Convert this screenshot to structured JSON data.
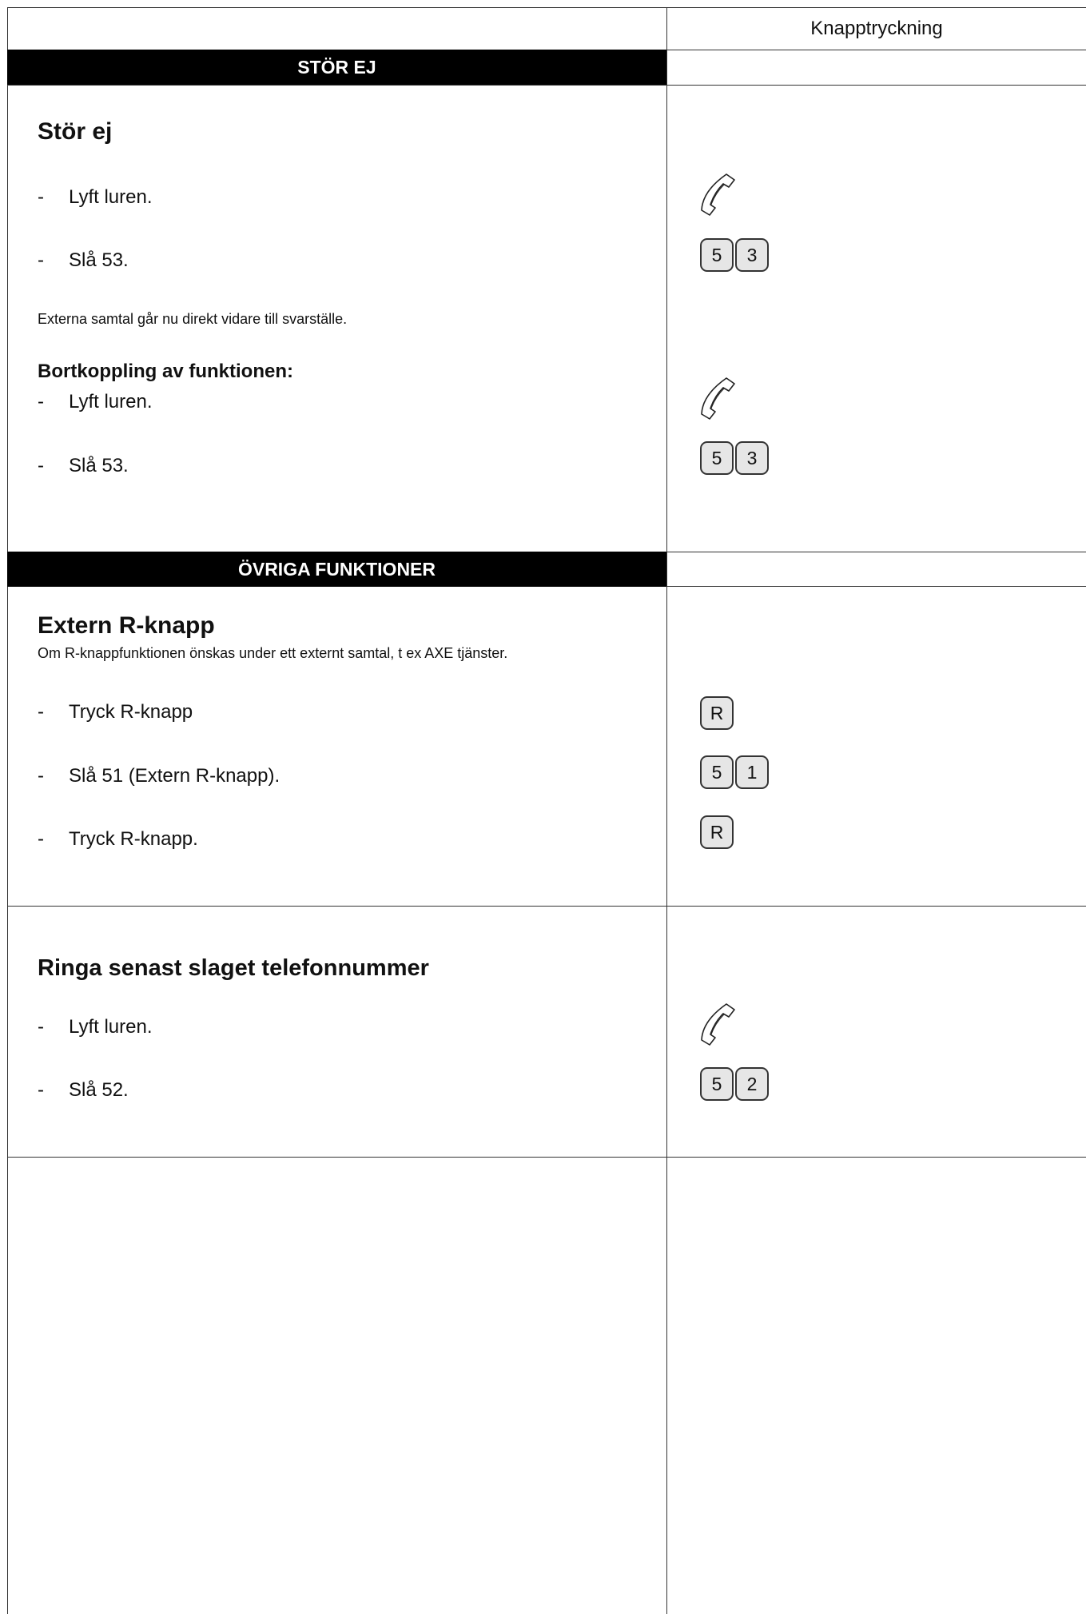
{
  "header": {
    "column_label": "Knapptryckning"
  },
  "sections": [
    {
      "banner": "STÖR EJ",
      "title": "Stör ej",
      "steps": [
        {
          "text": "Lyft luren.",
          "icon": "handset-icon"
        },
        {
          "text": "Slå 53.",
          "keys": [
            "5",
            "3"
          ]
        }
      ],
      "note": "Externa samtal går nu direkt vidare till svarställe.",
      "sub_heading": "Bortkoppling av funktionen:",
      "sub_steps": [
        {
          "text": "Lyft luren.",
          "icon": "handset-icon"
        },
        {
          "text": "Slå 53.",
          "keys": [
            "5",
            "3"
          ]
        }
      ]
    },
    {
      "banner": "ÖVRIGA FUNKTIONER",
      "title": "Extern R-knapp",
      "subtitle": "Om R-knappfunktionen önskas under ett externt samtal, t ex AXE tjänster.",
      "steps": [
        {
          "text": "Tryck R-knapp",
          "keys": [
            "R"
          ]
        },
        {
          "text": "Slå 51 (Extern R-knapp).",
          "keys": [
            "5",
            "1"
          ]
        },
        {
          "text": "Tryck R-knapp.",
          "keys": [
            "R"
          ]
        }
      ]
    },
    {
      "title": "Ringa senast slaget telefonnummer",
      "steps": [
        {
          "text": "Lyft luren.",
          "icon": "handset-icon"
        },
        {
          "text": "Slå 52.",
          "keys": [
            "5",
            "2"
          ]
        }
      ]
    }
  ],
  "step_dash": "-"
}
